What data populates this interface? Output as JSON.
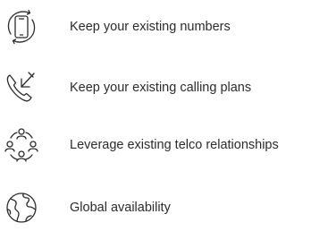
{
  "features": [
    {
      "label": "Keep your existing numbers",
      "icon": "phone-sync-icon"
    },
    {
      "label": "Keep your existing calling plans",
      "icon": "incoming-call-icon"
    },
    {
      "label": "Leverage existing telco relationships",
      "icon": "people-network-icon"
    },
    {
      "label": "Global availability",
      "icon": "globe-icon"
    }
  ],
  "colors": {
    "text": "#2b2b2b",
    "icon_stroke": "#2b2b2b",
    "background": "#ffffff"
  }
}
